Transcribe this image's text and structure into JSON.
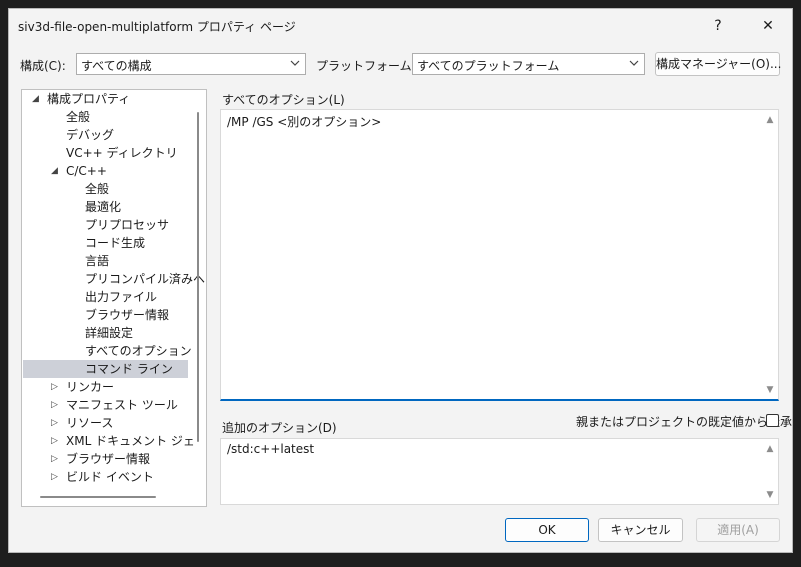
{
  "window": {
    "title": "siv3d-file-open-multiplatform プロパティ ページ",
    "help_glyph": "?",
    "close_glyph": "✕"
  },
  "config": {
    "label": "構成(C):",
    "value": "すべての構成",
    "platform_label": "プラットフォーム(P):",
    "platform_value": "すべてのプラットフォーム",
    "manager_button": "構成マネージャー(O)..."
  },
  "tree": {
    "items": [
      {
        "label": "構成プロパティ",
        "expander": "◢"
      },
      {
        "label": "全般"
      },
      {
        "label": "デバッグ"
      },
      {
        "label": "VC++ ディレクトリ"
      },
      {
        "label": "C/C++",
        "expander": "◢"
      },
      {
        "label": "全般"
      },
      {
        "label": "最適化"
      },
      {
        "label": "プリプロセッサ"
      },
      {
        "label": "コード生成"
      },
      {
        "label": "言語"
      },
      {
        "label": "プリコンパイル済みヘッ"
      },
      {
        "label": "出力ファイル"
      },
      {
        "label": "ブラウザー情報"
      },
      {
        "label": "詳細設定"
      },
      {
        "label": "すべてのオプション"
      },
      {
        "label": "コマンド ライン",
        "selected": true
      },
      {
        "label": "リンカー",
        "expander": "▷"
      },
      {
        "label": "マニフェスト ツール",
        "expander": "▷"
      },
      {
        "label": "リソース",
        "expander": "▷"
      },
      {
        "label": "XML ドキュメント ジェネレー",
        "expander": "▷"
      },
      {
        "label": "ブラウザー情報",
        "expander": "▷"
      },
      {
        "label": "ビルド イベント",
        "expander": "▷"
      }
    ]
  },
  "all_options": {
    "label": "すべてのオプション(L)",
    "value": "/MP /GS <別のオプション>"
  },
  "additional_options": {
    "label": "追加のオプション(D)",
    "inherit_label": "親またはプロジェクトの既定値から継承",
    "inherit_checked": false,
    "value": "/std:c++latest"
  },
  "buttons": {
    "ok": "OK",
    "cancel": "キャンセル",
    "apply": "適用(A)"
  },
  "colors": {
    "accent": "#0067c0",
    "selection": "#cdd0d8",
    "disabled_text": "#a0a0a0"
  }
}
